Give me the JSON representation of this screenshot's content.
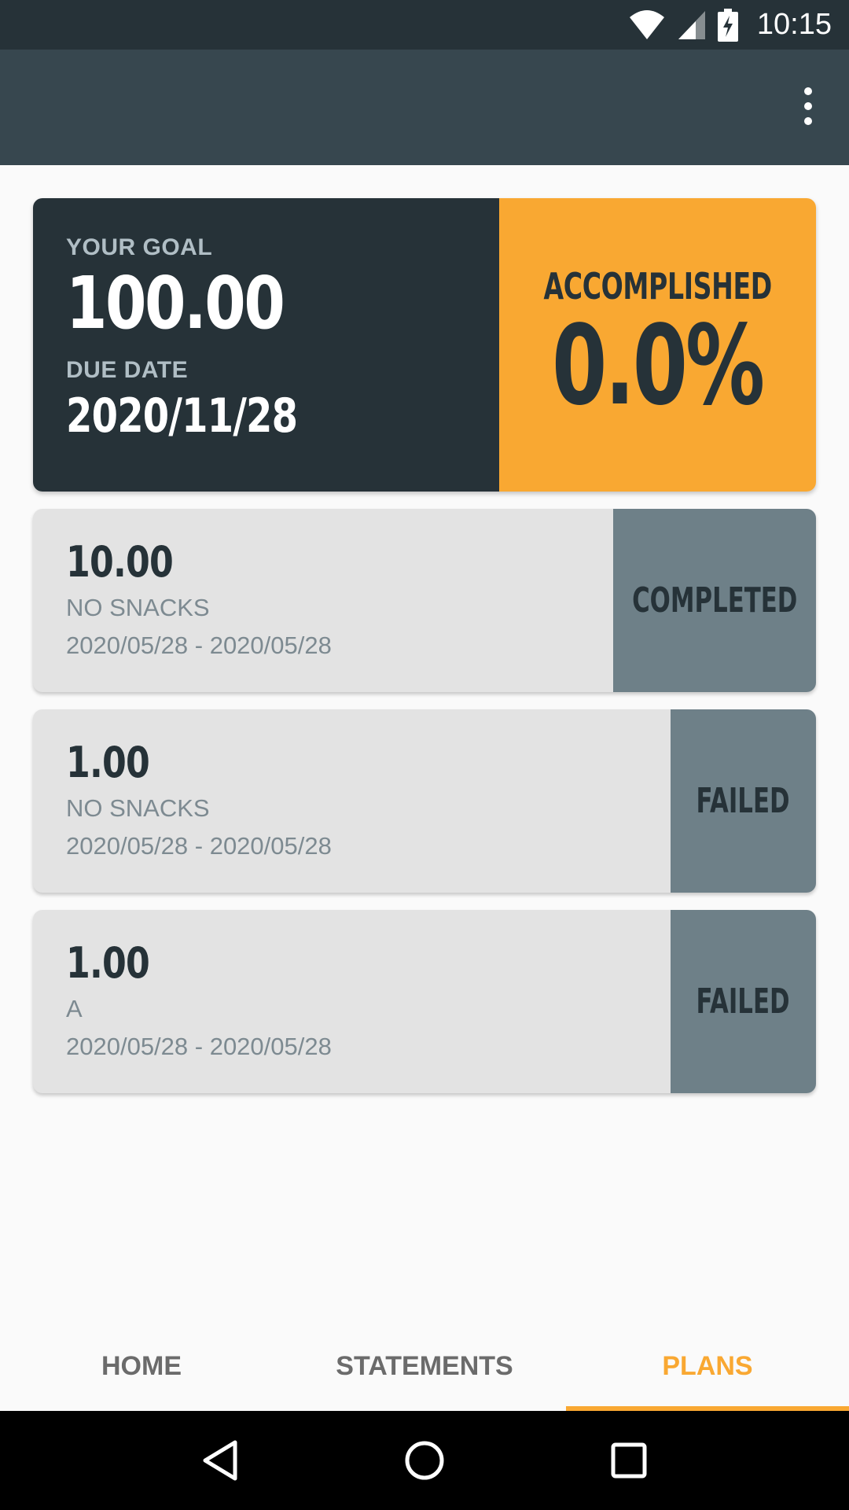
{
  "status_bar": {
    "time": "10:15",
    "icons": [
      "wifi-icon",
      "cell-signal-icon",
      "battery-charging-icon"
    ]
  },
  "app_bar": {
    "menu_icon": "more-vert-icon"
  },
  "goal": {
    "goal_label": "YOUR GOAL",
    "goal_amount": "100.00",
    "due_label": "DUE DATE",
    "due_date": "2020/11/28",
    "accomplished_label": "ACCOMPLISHED",
    "accomplished_value": "0.0%"
  },
  "plans": [
    {
      "amount": "10.00",
      "name": "NO SNACKS",
      "dates": "2020/05/28 - 2020/05/28",
      "status": "COMPLETED"
    },
    {
      "amount": "1.00",
      "name": "NO SNACKS",
      "dates": "2020/05/28 - 2020/05/28",
      "status": "FAILED"
    },
    {
      "amount": "1.00",
      "name": "A",
      "dates": "2020/05/28 - 2020/05/28",
      "status": "FAILED"
    }
  ],
  "tabs": [
    {
      "label": "HOME",
      "active": false
    },
    {
      "label": "STATEMENTS",
      "active": false
    },
    {
      "label": "PLANS",
      "active": true
    }
  ],
  "colors": {
    "accent": "#f9a832",
    "dark": "#263238",
    "app_bar": "#37474f",
    "status_panel": "#6e8088"
  },
  "nav_bar": {
    "icons": [
      "back-icon",
      "home-icon",
      "recents-icon"
    ]
  }
}
